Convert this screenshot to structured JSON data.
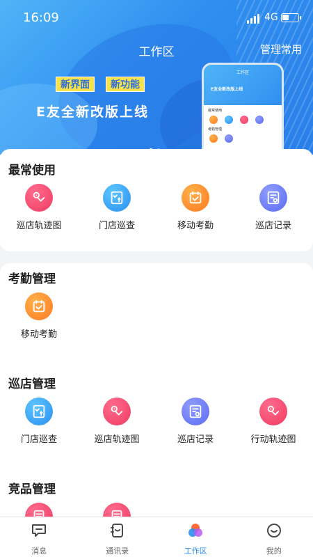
{
  "status_bar": {
    "time": "16:09",
    "network": "4G",
    "battery_level": 0.45
  },
  "header": {
    "title": "工作区",
    "manage_label": "管理常用",
    "banner": {
      "tags": [
        "新界面",
        "新功能"
      ],
      "slogan": "E友全新改版上线",
      "mockup_title": "工作区",
      "mockup_section1": "最常使用",
      "mockup_section2": "考勤管理",
      "active_page": 1,
      "page_count": 2
    }
  },
  "sections": [
    {
      "title": "最常使用",
      "items": [
        {
          "label": "巡店轨迹图",
          "icon": "route-map-icon",
          "color": "red"
        },
        {
          "label": "门店巡查",
          "icon": "checklist-icon",
          "color": "blue"
        },
        {
          "label": "移动考勤",
          "icon": "calendar-check-icon",
          "color": "orange"
        },
        {
          "label": "巡店记录",
          "icon": "record-icon",
          "color": "purple"
        }
      ]
    },
    {
      "title": "考勤管理",
      "items": [
        {
          "label": "移动考勤",
          "icon": "calendar-check-icon",
          "color": "orange"
        }
      ]
    },
    {
      "title": "巡店管理",
      "items": [
        {
          "label": "门店巡查",
          "icon": "checklist-icon",
          "color": "blue"
        },
        {
          "label": "巡店轨迹图",
          "icon": "route-map-icon",
          "color": "red"
        },
        {
          "label": "巡店记录",
          "icon": "record-icon",
          "color": "purple"
        },
        {
          "label": "行动轨迹图",
          "icon": "route-map-icon",
          "color": "red"
        }
      ]
    },
    {
      "title": "竞品管理",
      "items": [
        {
          "label": "",
          "icon": "document-icon",
          "color": "red"
        },
        {
          "label": "",
          "icon": "document-icon",
          "color": "red"
        }
      ]
    }
  ],
  "tabbar": [
    {
      "label": "消息",
      "icon": "message-icon",
      "active": false
    },
    {
      "label": "通讯录",
      "icon": "contacts-icon",
      "active": false
    },
    {
      "label": "工作区",
      "icon": "workspace-icon",
      "active": true
    },
    {
      "label": "我的",
      "icon": "profile-icon",
      "active": false
    }
  ],
  "colors": {
    "accent": "#2a8ff0",
    "red": "#ef3b63",
    "blue": "#2a8ff0",
    "orange": "#ff7a22",
    "purple": "#5b6cf0"
  }
}
